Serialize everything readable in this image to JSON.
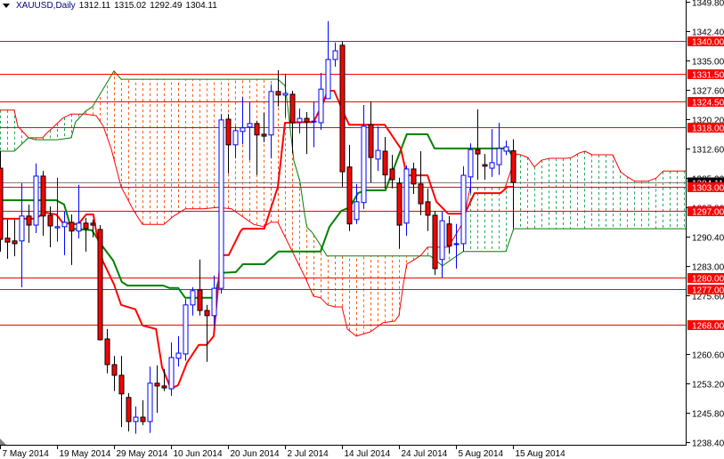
{
  "header": {
    "symbol": "XAUUSD,Daily",
    "open": "1312.11",
    "high": "1315.02",
    "low": "1292.49",
    "close": "1304.11"
  },
  "colors": {
    "bull": "#0000ff",
    "bear": "#ff0000",
    "tenkan": "#ff0000",
    "kijun": "#008000",
    "span_a": "#ff0000",
    "span_b": "#008000",
    "cloud_bear": "#ff5a14",
    "cloud_bull": "#22aa55",
    "level": "#ff0000",
    "bid": "#808080"
  },
  "chart_data": {
    "type": "candlestick",
    "title": "XAUUSD,Daily",
    "ylim": [
      1238.4,
      1349.8
    ],
    "grid": false,
    "y_ticks": [
      "1349.80",
      "1342.40",
      "1335.00",
      "1327.60",
      "1320.20",
      "1312.60",
      "1305.20",
      "1297.80",
      "1290.40",
      "1283.00",
      "1275.60",
      "1260.60",
      "1253.20",
      "1245.80",
      "1238.40"
    ],
    "x_ticks": [
      {
        "bar": 0,
        "label": "7 May 2014"
      },
      {
        "bar": 8,
        "label": "19 May 2014"
      },
      {
        "bar": 16,
        "label": "29 May 2014"
      },
      {
        "bar": 24,
        "label": "10 Jun 2014"
      },
      {
        "bar": 32,
        "label": "20 Jun 2014"
      },
      {
        "bar": 40,
        "label": "2 Jul 2014"
      },
      {
        "bar": 48,
        "label": "14 Jul 2014"
      },
      {
        "bar": 56,
        "label": "24 Jul 2014"
      },
      {
        "bar": 64,
        "label": "5 Aug 2014"
      },
      {
        "bar": 72,
        "label": "15 Aug 2014"
      }
    ],
    "levels": [
      {
        "price": 1340.0,
        "label": "1340.00"
      },
      {
        "price": 1331.5,
        "label": "1331.50"
      },
      {
        "price": 1324.5,
        "label": "1324.50"
      },
      {
        "price": 1318.0,
        "label": "1318.00"
      },
      {
        "price": 1303.0,
        "label": "1303.00"
      },
      {
        "price": 1297.0,
        "label": "1297.00"
      },
      {
        "price": 1280.0,
        "label": "1280.00"
      },
      {
        "price": 1277.0,
        "label": "1277.00"
      },
      {
        "price": 1268.0,
        "label": "1268.00"
      }
    ],
    "bid": {
      "price": 1304.11,
      "label": "1304.11"
    },
    "candles_ohlc": [
      [
        1307.7,
        1312,
        1286.6,
        1289.7
      ],
      [
        1290,
        1294.7,
        1284.8,
        1289
      ],
      [
        1289.3,
        1294.7,
        1285.4,
        1288.6
      ],
      [
        1289.3,
        1303.9,
        1277.6,
        1295.6
      ],
      [
        1295.6,
        1298.5,
        1288.8,
        1293.3
      ],
      [
        1293.3,
        1308.9,
        1291.3,
        1305.7
      ],
      [
        1305.7,
        1307,
        1290.6,
        1295.6
      ],
      [
        1295.8,
        1298,
        1287.7,
        1293.1
      ],
      [
        1292.6,
        1305.3,
        1289.1,
        1292.9
      ],
      [
        1292.9,
        1296.7,
        1285.7,
        1294
      ],
      [
        1294,
        1296,
        1283.2,
        1291.8
      ],
      [
        1291.8,
        1303.5,
        1289.9,
        1293.8
      ],
      [
        1293.8,
        1295.1,
        1286.6,
        1292.4
      ],
      [
        1293.8,
        1294.7,
        1290.2,
        1293.3
      ],
      [
        1292.2,
        1293.3,
        1264.1,
        1264.3
      ],
      [
        1264.5,
        1267,
        1255.8,
        1258
      ],
      [
        1258,
        1260.2,
        1251.3,
        1255.3
      ],
      [
        1255.3,
        1260.2,
        1242.2,
        1250.6
      ],
      [
        1249.7,
        1250.8,
        1241.1,
        1243.6
      ],
      [
        1243.6,
        1247.4,
        1240.5,
        1244.7
      ],
      [
        1244.7,
        1249,
        1242.7,
        1243.6
      ],
      [
        1243.6,
        1257.5,
        1240.7,
        1253.3
      ],
      [
        1253.3,
        1257.8,
        1245.8,
        1252.6
      ],
      [
        1252.6,
        1256.9,
        1251.3,
        1252.1
      ],
      [
        1251.9,
        1263.6,
        1250.1,
        1259.8
      ],
      [
        1259.6,
        1265.2,
        1257.5,
        1260.9
      ],
      [
        1260.7,
        1274.6,
        1259,
        1273.1
      ],
      [
        1273.1,
        1277.6,
        1270.4,
        1276.7
      ],
      [
        1276.9,
        1284.6,
        1270.4,
        1271.7
      ],
      [
        1271.7,
        1273.1,
        1258.7,
        1270.4
      ],
      [
        1270.4,
        1280.5,
        1267.7,
        1277.3
      ],
      [
        1277.3,
        1321.4,
        1276,
        1319.9
      ],
      [
        1320.1,
        1321.4,
        1306.4,
        1313.6
      ],
      [
        1313.6,
        1318.3,
        1310.2,
        1317.2
      ],
      [
        1317,
        1325.7,
        1313.8,
        1317.9
      ],
      [
        1318.1,
        1324.4,
        1309.7,
        1319
      ],
      [
        1319,
        1319.7,
        1306,
        1316.1
      ],
      [
        1316.3,
        1321.7,
        1314.3,
        1315.8
      ],
      [
        1316.1,
        1328.9,
        1310.2,
        1327.1
      ],
      [
        1327.1,
        1332.5,
        1323.3,
        1326.2
      ],
      [
        1326.2,
        1331.6,
        1320.6,
        1326.6
      ],
      [
        1326.4,
        1327.3,
        1311.5,
        1319.2
      ],
      [
        1319.4,
        1322.8,
        1316.5,
        1320.3
      ],
      [
        1320.3,
        1321.9,
        1311.3,
        1319.4
      ],
      [
        1319.4,
        1324.6,
        1313,
        1319.6
      ],
      [
        1319.2,
        1331.8,
        1317.4,
        1327.7
      ],
      [
        1325.3,
        1344.9,
        1325.3,
        1335.2
      ],
      [
        1335.2,
        1339.5,
        1333.4,
        1337.4
      ],
      [
        1338.8,
        1339.7,
        1303,
        1306.8
      ],
      [
        1308,
        1313.6,
        1291.8,
        1293.6
      ],
      [
        1294.7,
        1303.7,
        1293.6,
        1299.2
      ],
      [
        1299,
        1323.7,
        1297.4,
        1318.3
      ],
      [
        1318.7,
        1324.6,
        1304.1,
        1310.4
      ],
      [
        1310,
        1318.3,
        1307,
        1312.2
      ],
      [
        1312,
        1315.6,
        1302.6,
        1306
      ],
      [
        1307.5,
        1311.1,
        1302.6,
        1304.8
      ],
      [
        1303.9,
        1305.3,
        1287.3,
        1293.3
      ],
      [
        1293.8,
        1308.4,
        1290.6,
        1307.5
      ],
      [
        1307.5,
        1309.1,
        1301.2,
        1303.7
      ],
      [
        1303.7,
        1312,
        1295.8,
        1298.7
      ],
      [
        1299.2,
        1302.6,
        1291.8,
        1295.8
      ],
      [
        1295.8,
        1296.9,
        1280.7,
        1282.3
      ],
      [
        1284.6,
        1296.9,
        1280,
        1294.4
      ],
      [
        1293.6,
        1295.6,
        1286.1,
        1288
      ],
      [
        1288.4,
        1293.6,
        1282.3,
        1288.6
      ],
      [
        1288.6,
        1308.2,
        1286.6,
        1305.9
      ],
      [
        1305.5,
        1314,
        1301.4,
        1312.4
      ],
      [
        1312.4,
        1322.6,
        1304.8,
        1311.3
      ],
      [
        1308.6,
        1311.3,
        1304.8,
        1308.2
      ],
      [
        1307.7,
        1317.6,
        1305.5,
        1309.1
      ],
      [
        1308.6,
        1319.2,
        1306,
        1312.7
      ],
      [
        1312,
        1314.7,
        1311,
        1313.1
      ],
      [
        1312.11,
        1315.02,
        1292.49,
        1304.11
      ]
    ],
    "tenkan": [
      [
        0,
        1294.9
      ],
      [
        5,
        1294.9
      ],
      [
        6.25,
        1296.5
      ],
      [
        7.9,
        1296
      ],
      [
        8.75,
        1294
      ],
      [
        10,
        1293.55
      ],
      [
        11,
        1293.55
      ],
      [
        12.1,
        1296
      ],
      [
        13.1,
        1296
      ],
      [
        13.5,
        1291.7
      ],
      [
        14.4,
        1284.3
      ],
      [
        16,
        1278.3
      ],
      [
        17,
        1273.1
      ],
      [
        19,
        1272
      ],
      [
        20,
        1267.9
      ],
      [
        21.9,
        1267
      ],
      [
        22.75,
        1257.3
      ],
      [
        24,
        1251.9
      ],
      [
        25,
        1252.8
      ],
      [
        26.25,
        1258.5
      ],
      [
        27.9,
        1263
      ],
      [
        29,
        1263
      ],
      [
        30,
        1265.2
      ],
      [
        31,
        1285.7
      ],
      [
        32.1,
        1285.7
      ],
      [
        33.75,
        1291.7
      ],
      [
        34.1,
        1292.4
      ],
      [
        37.1,
        1292.4
      ],
      [
        39,
        1303
      ],
      [
        40,
        1319.2
      ],
      [
        44,
        1319.4
      ],
      [
        45.25,
        1323.7
      ],
      [
        46,
        1327.3
      ],
      [
        46.9,
        1327.3
      ],
      [
        48.4,
        1321
      ],
      [
        49,
        1318.7
      ],
      [
        54,
        1318.7
      ],
      [
        56.25,
        1312.7
      ],
      [
        57.1,
        1305.9
      ],
      [
        60,
        1305.9
      ],
      [
        61.25,
        1299.2
      ],
      [
        62.9,
        1296.2
      ],
      [
        65.25,
        1296.2
      ],
      [
        66.6,
        1301.4
      ],
      [
        70.25,
        1301.4
      ],
      [
        71.25,
        1303
      ],
      [
        72,
        1303
      ]
    ],
    "kijun": [
      [
        0,
        1299.6
      ],
      [
        7.9,
        1299.6
      ],
      [
        9,
        1298.5
      ],
      [
        10,
        1292.4
      ],
      [
        12.9,
        1292
      ],
      [
        14.4,
        1287.9
      ],
      [
        15.9,
        1284.3
      ],
      [
        17.1,
        1278.9
      ],
      [
        17.9,
        1278
      ],
      [
        22.9,
        1278
      ],
      [
        23.75,
        1277.4
      ],
      [
        25,
        1277.4
      ],
      [
        26,
        1274.9
      ],
      [
        30,
        1274.9
      ],
      [
        31,
        1281.2
      ],
      [
        33.1,
        1281.4
      ],
      [
        34.1,
        1283.4
      ],
      [
        37.1,
        1283.4
      ],
      [
        39.1,
        1286.6
      ],
      [
        45,
        1286.6
      ],
      [
        46.25,
        1292.9
      ],
      [
        47.9,
        1296.9
      ],
      [
        49.1,
        1297.8
      ],
      [
        50.25,
        1301.4
      ],
      [
        51.25,
        1302.1
      ],
      [
        54.1,
        1302.1
      ],
      [
        57.1,
        1316.3
      ],
      [
        60,
        1316.3
      ],
      [
        61,
        1312.7
      ],
      [
        71.25,
        1312.7
      ],
      [
        72.1,
        1310.4
      ]
    ],
    "senkou_a": [
      [
        0,
        1322.4
      ],
      [
        2,
        1322.4
      ],
      [
        2.5,
        1318.3
      ],
      [
        4,
        1315.4
      ],
      [
        6,
        1315.4
      ],
      [
        6.5,
        1316.5
      ],
      [
        7.5,
        1318.1
      ],
      [
        8.75,
        1320.3
      ],
      [
        10,
        1321.4
      ],
      [
        12,
        1321.4
      ],
      [
        13.5,
        1321
      ],
      [
        14.5,
        1318.3
      ],
      [
        15.6,
        1312.7
      ],
      [
        17,
        1303
      ],
      [
        18.75,
        1297
      ],
      [
        20,
        1293.5
      ],
      [
        23,
        1293.5
      ],
      [
        24.4,
        1295.6
      ],
      [
        26,
        1297.4
      ],
      [
        28.5,
        1297.4
      ],
      [
        30.6,
        1297.8
      ],
      [
        32.5,
        1297.4
      ],
      [
        33.75,
        1295.8
      ],
      [
        35.6,
        1293.5
      ],
      [
        37,
        1292.9
      ],
      [
        38,
        1294
      ],
      [
        39,
        1294
      ],
      [
        42.9,
        1279.8
      ],
      [
        44,
        1275.3
      ],
      [
        45,
        1274.9
      ],
      [
        46,
        1273.1
      ],
      [
        47,
        1272.6
      ],
      [
        48,
        1272.6
      ],
      [
        48.75,
        1267
      ],
      [
        50,
        1265.2
      ],
      [
        52,
        1266.3
      ],
      [
        53.75,
        1268.6
      ],
      [
        55.4,
        1269
      ],
      [
        56,
        1270.4
      ],
      [
        56.6,
        1278.2
      ],
      [
        57.1,
        1283.4
      ],
      [
        58.1,
        1284.5
      ],
      [
        59.1,
        1285.7
      ],
      [
        60,
        1287.7
      ],
      [
        62.9,
        1287.7
      ],
      [
        63.75,
        1290.2
      ],
      [
        65,
        1294
      ],
      [
        66,
        1302.8
      ],
      [
        70.9,
        1302.8
      ],
      [
        72.5,
        1311.3
      ],
      [
        73.1,
        1311.1
      ],
      [
        74.1,
        1310.4
      ],
      [
        75,
        1308
      ],
      [
        76,
        1309.7
      ],
      [
        77.1,
        1310.2
      ],
      [
        79.4,
        1310.2
      ],
      [
        80.25,
        1310.4
      ],
      [
        81.25,
        1311.5
      ],
      [
        82.1,
        1312
      ],
      [
        83.1,
        1311.1
      ],
      [
        86,
        1311.1
      ],
      [
        87.1,
        1306.8
      ],
      [
        87.9,
        1305.7
      ],
      [
        89.1,
        1304.4
      ],
      [
        90.9,
        1304.4
      ],
      [
        92.1,
        1305.2
      ],
      [
        93.1,
        1307
      ],
      [
        96.25,
        1307
      ]
    ],
    "senkou_b": [
      [
        0,
        1312
      ],
      [
        2,
        1312
      ],
      [
        4,
        1315.4
      ],
      [
        5,
        1314.9
      ],
      [
        8,
        1314.9
      ],
      [
        10,
        1315.4
      ],
      [
        10.6,
        1319.4
      ],
      [
        12,
        1322.1
      ],
      [
        13,
        1323.3
      ],
      [
        16,
        1332.3
      ],
      [
        17,
        1330.2
      ],
      [
        39,
        1330.2
      ],
      [
        40,
        1328.6
      ],
      [
        40.4,
        1323.1
      ],
      [
        41.25,
        1309.6
      ],
      [
        42.1,
        1304.4
      ],
      [
        42.75,
        1296.1
      ],
      [
        43.1,
        1292.7
      ],
      [
        43.75,
        1291.6
      ],
      [
        44.75,
        1288.9
      ],
      [
        45.9,
        1285.5
      ],
      [
        60.4,
        1285.5
      ],
      [
        62.1,
        1283
      ],
      [
        65,
        1286.6
      ],
      [
        71,
        1286.6
      ],
      [
        72.1,
        1292.4
      ],
      [
        96.25,
        1292.4
      ]
    ]
  }
}
